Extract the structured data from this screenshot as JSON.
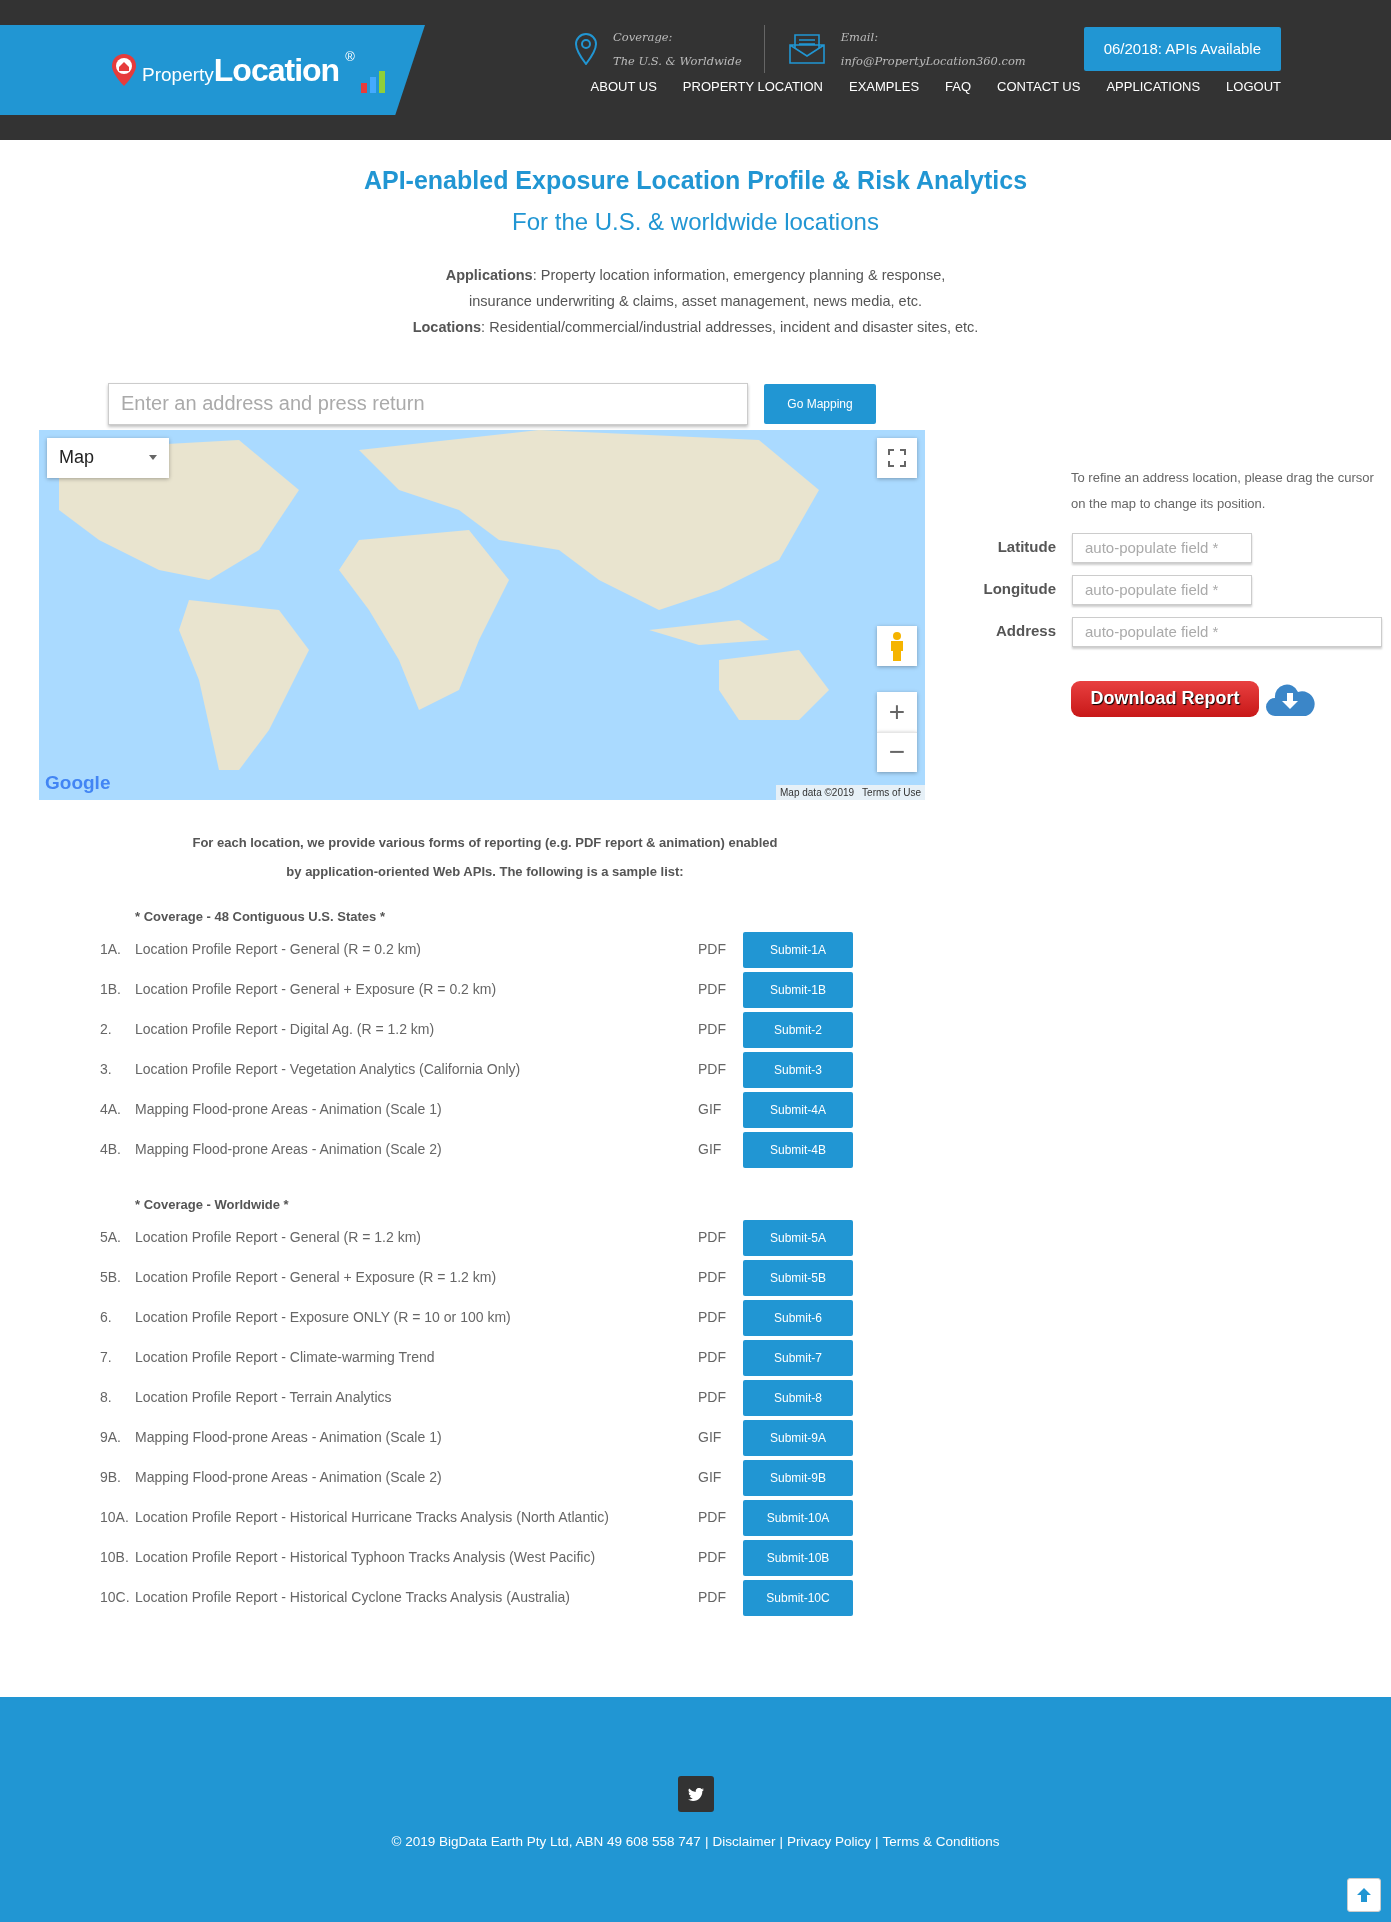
{
  "header": {
    "logo": {
      "word_small": "Property",
      "word_big": "Location",
      "mark": "®"
    },
    "contacts": [
      {
        "kind": "pin",
        "label": "Coverage:",
        "value": "The U.S. & Worldwide"
      },
      {
        "kind": "mail",
        "label": "Email:",
        "value": "info@PropertyLocation360.com"
      }
    ],
    "announcement": "06/2018: APIs Available",
    "nav": [
      "ABOUT US",
      "PROPERTY LOCATION",
      "EXAMPLES",
      "FAQ",
      "CONTACT US",
      "APPLICATIONS",
      "LOGOUT"
    ]
  },
  "hero": {
    "title": "API-enabled Exposure Location Profile & Risk Analytics",
    "subtitle": "For the U.S. & worldwide locations",
    "paragraphs": [
      "**Applications**: Property location information, emergency planning & response, insurance underwriting & claims, asset management, news media, etc.",
      "**Locations**: Residential/commercial/industrial addresses, incident and disaster sites, etc."
    ]
  },
  "search": {
    "placeholder": "Enter an address and press return",
    "button": "Go Mapping"
  },
  "map": {
    "type_control": "Map",
    "logo": "Google",
    "attribution": "Map data ©2019",
    "terms": "Terms of Use",
    "zoom_in": "+",
    "zoom_out": "−"
  },
  "refine": {
    "hint": "To refine an address location, please drag the cursor on the map to change its position.",
    "fields": [
      {
        "label": "Latitude",
        "placeholder": "auto-populate field *",
        "wide": false
      },
      {
        "label": "Longitude",
        "placeholder": "auto-populate field *",
        "wide": false
      },
      {
        "label": "Address",
        "placeholder": "auto-populate field *",
        "wide": true
      }
    ],
    "download": "Download Report"
  },
  "reports": {
    "intro": "For each location, we provide various forms of reporting (e.g. PDF report & animation) enabled by application-oriented Web APIs. The following is a sample list:",
    "sections": [
      {
        "heading": "* Coverage - 48 Contiguous U.S. States *",
        "items": [
          {
            "number": "1A.",
            "title": "Location Profile Report - General (R = 0.2 km)",
            "format": "PDF",
            "button": "Submit-1A"
          },
          {
            "number": "1B.",
            "title": "Location Profile Report - General + Exposure (R = 0.2 km)",
            "format": "PDF",
            "button": "Submit-1B"
          },
          {
            "number": "2.",
            "title": "Location Profile Report - Digital Ag. (R = 1.2 km)",
            "format": "PDF",
            "button": "Submit-2"
          },
          {
            "number": "3.",
            "title": "Location Profile Report - Vegetation Analytics (California Only)",
            "format": "PDF",
            "button": "Submit-3"
          },
          {
            "number": "4A.",
            "title": "Mapping Flood-prone Areas - Animation (Scale 1)",
            "format": "GIF",
            "button": "Submit-4A"
          },
          {
            "number": "4B.",
            "title": "Mapping Flood-prone Areas - Animation (Scale 2)",
            "format": "GIF",
            "button": "Submit-4B"
          }
        ]
      },
      {
        "heading": "* Coverage - Worldwide *",
        "items": [
          {
            "number": "5A.",
            "title": "Location Profile Report - General (R = 1.2 km)",
            "format": "PDF",
            "button": "Submit-5A"
          },
          {
            "number": "5B.",
            "title": "Location Profile Report - General + Exposure (R = 1.2 km)",
            "format": "PDF",
            "button": "Submit-5B"
          },
          {
            "number": "6.",
            "title": "Location Profile Report - Exposure ONLY (R = 10 or 100 km)",
            "format": "PDF",
            "button": "Submit-6"
          },
          {
            "number": "7.",
            "title": "Location Profile Report - Climate-warming Trend",
            "format": "PDF",
            "button": "Submit-7"
          },
          {
            "number": "8.",
            "title": "Location Profile Report - Terrain Analytics",
            "format": "PDF",
            "button": "Submit-8"
          },
          {
            "number": "9A.",
            "title": "Mapping Flood-prone Areas - Animation (Scale 1)",
            "format": "GIF",
            "button": "Submit-9A"
          },
          {
            "number": "9B.",
            "title": "Mapping Flood-prone Areas - Animation (Scale 2)",
            "format": "GIF",
            "button": "Submit-9B"
          },
          {
            "number": "10A.",
            "title": "Location Profile Report - Historical Hurricane Tracks Analysis (North Atlantic)",
            "format": "PDF",
            "button": "Submit-10A"
          },
          {
            "number": "10B.",
            "title": "Location Profile Report - Historical Typhoon Tracks Analysis (West Pacific)",
            "format": "PDF",
            "button": "Submit-10B"
          },
          {
            "number": "10C.",
            "title": "Location Profile Report - Historical Cyclone Tracks Analysis (Australia)",
            "format": "PDF",
            "button": "Submit-10C"
          }
        ]
      }
    ]
  },
  "footer": {
    "copyright": "© 2019 BigData Earth Pty Ltd, ABN 49 608 558 747",
    "separator": "|",
    "links": [
      "Disclaimer",
      "Privacy Policy",
      "Terms & Conditions"
    ]
  }
}
